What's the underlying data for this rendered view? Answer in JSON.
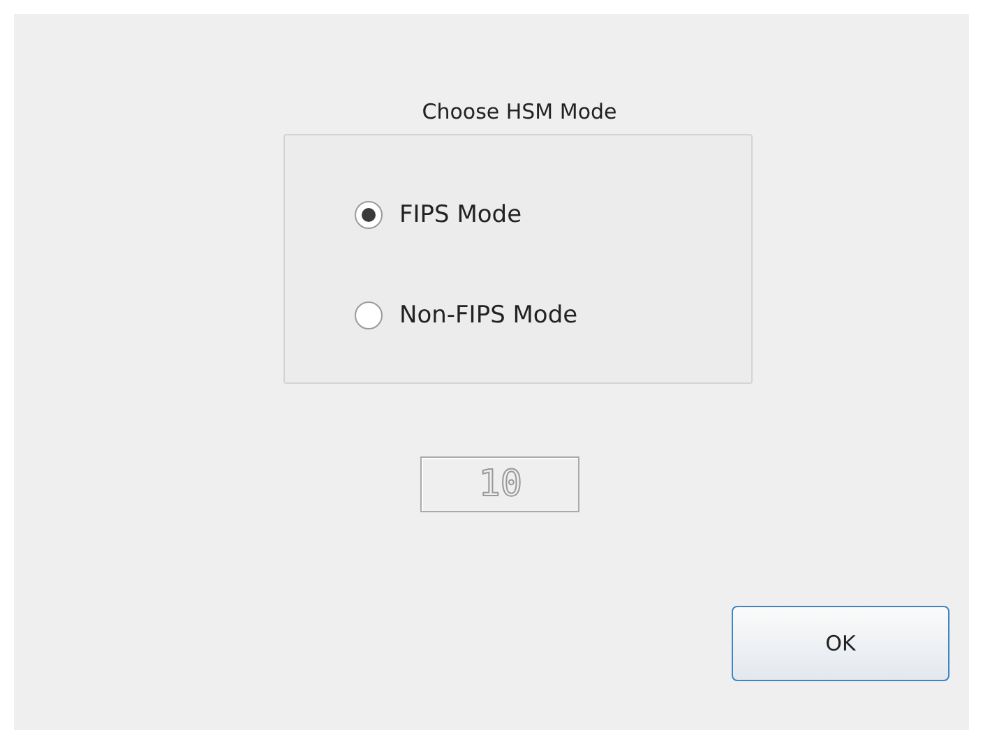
{
  "group": {
    "title": "Choose HSM Mode",
    "options": [
      {
        "label": "FIPS Mode",
        "selected": true
      },
      {
        "label": "Non-FIPS Mode",
        "selected": false
      }
    ]
  },
  "lcd": {
    "value": "10"
  },
  "buttons": [
    "OK"
  ]
}
